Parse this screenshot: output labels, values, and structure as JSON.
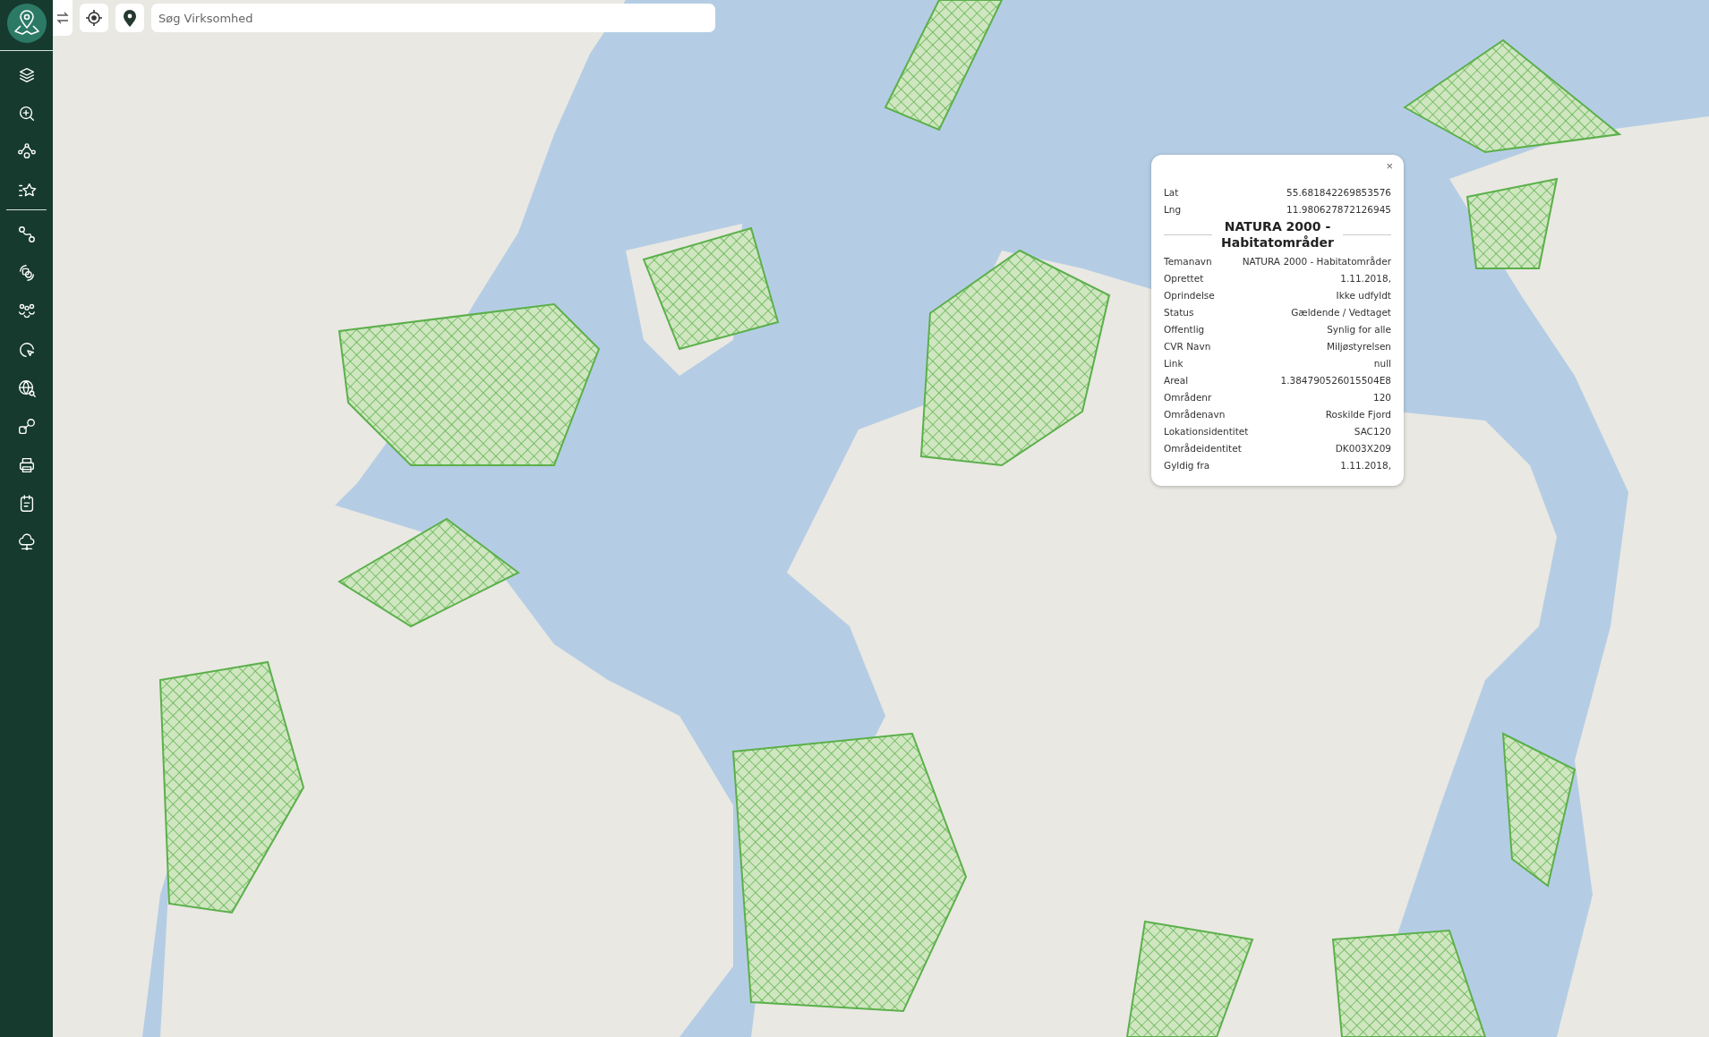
{
  "search": {
    "placeholder": "Søg Virksomhed"
  },
  "popup": {
    "close": "×",
    "coordinates": [
      {
        "label": "Lat",
        "value": "55.681842269853576"
      },
      {
        "label": "Lng",
        "value": "11.980627872126945"
      }
    ],
    "title": "NATURA 2000 - Habitatområder",
    "attributes": [
      {
        "label": "Temanavn",
        "value": "NATURA 2000 - Habitatområder"
      },
      {
        "label": "Oprettet",
        "value": "1.11.2018,"
      },
      {
        "label": "Oprindelse",
        "value": "Ikke udfyldt"
      },
      {
        "label": "Status",
        "value": "Gældende / Vedtaget"
      },
      {
        "label": "Offentlig",
        "value": "Synlig for alle"
      },
      {
        "label": "CVR Navn",
        "value": "Miljøstyrelsen"
      },
      {
        "label": "Link",
        "value": "null"
      },
      {
        "label": "Areal",
        "value": "1.384790526015504E8"
      },
      {
        "label": "Områdenr",
        "value": "120"
      },
      {
        "label": "Områdenavn",
        "value": "Roskilde Fjord"
      },
      {
        "label": "Lokationsidentitet",
        "value": "SAC120"
      },
      {
        "label": "Områdeidentitet",
        "value": "DK003X209"
      },
      {
        "label": "Gyldig fra",
        "value": "1.11.2018,"
      }
    ]
  }
}
